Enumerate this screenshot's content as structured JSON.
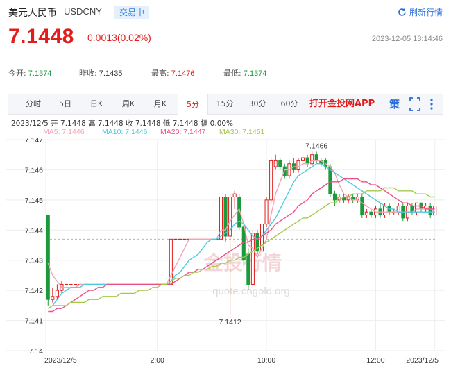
{
  "header": {
    "pair_name": "美元人民币",
    "pair_code": "USDCNY",
    "status": "交易中",
    "refresh_label": "刷新行情"
  },
  "quote": {
    "price": "7.1448",
    "change": "0.0013(0.02%)",
    "timestamp": "2023-12-05 13:14:46"
  },
  "stats": {
    "open_label": "今开:",
    "open": "7.1374",
    "prev_close_label": "昨收:",
    "prev_close": "7.1435",
    "high_label": "最高:",
    "high": "7.1476",
    "low_label": "最低:",
    "low": "7.1374"
  },
  "tabs": [
    "分时",
    "5日",
    "日K",
    "周K",
    "月K",
    "5分",
    "15分",
    "30分",
    "60分"
  ],
  "active_tab": "5分",
  "promo": "打开金投网APP",
  "icons": {
    "strategy": "策",
    "fullscreen": "fullscreen-icon",
    "more": "more-icon"
  },
  "chart_info": {
    "ohlc": "2023/12/5  开 7.1448  高 7.1448  收 7.1448  低 7.1448  幅 0.00%",
    "ma5": "MA5: 7.1446",
    "ma10": "MA10: 7.1446",
    "ma20": "MA20: 7.1447",
    "ma30": "MA30: 7.1451"
  },
  "watermark": "金投行情",
  "watermark_url": "quote.cngold.org",
  "colors": {
    "up": "#e21b1b",
    "down": "#1a9a3a",
    "ma5": "#f4a3b3",
    "ma10": "#4cc9e0",
    "ma20": "#ea4f88",
    "ma30": "#a6c84c"
  },
  "chart_data": {
    "type": "candlestick",
    "ylim": [
      7.14,
      7.147
    ],
    "yticks": [
      "7.147",
      "7.146",
      "7.145",
      "7.144",
      "7.143",
      "7.142",
      "7.141",
      "7.14"
    ],
    "xticks": [
      {
        "label": "2023/12/5",
        "idx": 0
      },
      {
        "label": "2:00",
        "idx": 24
      },
      {
        "label": "10:00",
        "idx": 48
      },
      {
        "label": "12:00",
        "idx": 72
      },
      {
        "label": "2023/12/5",
        "idx": 85
      }
    ],
    "annotations": [
      {
        "label": "7.1466",
        "idx": 59,
        "value": 7.14664
      },
      {
        "label": "7.1412",
        "idx": 40,
        "value": 7.1412
      }
    ],
    "prev_close": 7.1435,
    "candles": [
      [
        7.1445,
        7.1417,
        7.1445,
        7.1415
      ],
      [
        7.1417,
        7.1418,
        7.1421,
        7.1416
      ],
      [
        7.1418,
        7.142,
        7.1422,
        7.1417
      ],
      [
        7.142,
        7.1422,
        7.1423,
        7.1419
      ],
      [
        7.1422,
        7.1422,
        7.1422,
        7.1422
      ],
      [
        7.1422,
        7.1422,
        7.1422,
        7.1422
      ],
      [
        7.1422,
        7.1422,
        7.1422,
        7.1422
      ],
      [
        7.1422,
        7.1422,
        7.1422,
        7.1422
      ],
      [
        7.1422,
        7.1422,
        7.1422,
        7.1422
      ],
      [
        7.1422,
        7.1422,
        7.1422,
        7.1422
      ],
      [
        7.1422,
        7.1422,
        7.1422,
        7.1422
      ],
      [
        7.1422,
        7.1422,
        7.1422,
        7.1422
      ],
      [
        7.1422,
        7.1422,
        7.1422,
        7.1422
      ],
      [
        7.1422,
        7.1422,
        7.1422,
        7.1422
      ],
      [
        7.1422,
        7.1422,
        7.1422,
        7.1422
      ],
      [
        7.1422,
        7.1422,
        7.1422,
        7.1422
      ],
      [
        7.1422,
        7.1422,
        7.1422,
        7.1422
      ],
      [
        7.1422,
        7.1422,
        7.1422,
        7.1422
      ],
      [
        7.1422,
        7.1422,
        7.1422,
        7.1422
      ],
      [
        7.1422,
        7.1422,
        7.1422,
        7.1422
      ],
      [
        7.1422,
        7.1422,
        7.1422,
        7.1422
      ],
      [
        7.1422,
        7.1422,
        7.1422,
        7.1422
      ],
      [
        7.1422,
        7.1422,
        7.1422,
        7.1422
      ],
      [
        7.1422,
        7.1422,
        7.1422,
        7.1422
      ],
      [
        7.1422,
        7.1422,
        7.1422,
        7.1422
      ],
      [
        7.1422,
        7.1422,
        7.1422,
        7.1422
      ],
      [
        7.1422,
        7.1422,
        7.1422,
        7.1422
      ],
      [
        7.1422,
        7.1437,
        7.1437,
        7.1422
      ],
      [
        7.1437,
        7.1437,
        7.1437,
        7.1437
      ],
      [
        7.1437,
        7.1437,
        7.1437,
        7.1437
      ],
      [
        7.1437,
        7.1437,
        7.1437,
        7.1437
      ],
      [
        7.1437,
        7.1437,
        7.1437,
        7.1437
      ],
      [
        7.1437,
        7.1437,
        7.1437,
        7.1437
      ],
      [
        7.1437,
        7.1437,
        7.1437,
        7.1437
      ],
      [
        7.1437,
        7.1437,
        7.1437,
        7.1437
      ],
      [
        7.1437,
        7.1437,
        7.1437,
        7.1437
      ],
      [
        7.1437,
        7.1437,
        7.1437,
        7.1437
      ],
      [
        7.1437,
        7.1437,
        7.1437,
        7.1437
      ],
      [
        7.1437,
        7.1451,
        7.1451,
        7.1437
      ],
      [
        7.1451,
        7.1438,
        7.1452,
        7.1436
      ],
      [
        7.1438,
        7.1451,
        7.1452,
        7.1412
      ],
      [
        7.1451,
        7.1452,
        7.1453,
        7.1447
      ],
      [
        7.1451,
        7.1441,
        7.1452,
        7.144
      ],
      [
        7.1441,
        7.143,
        7.1442,
        7.1428
      ],
      [
        7.1432,
        7.1422,
        7.1434,
        7.142
      ],
      [
        7.1422,
        7.1439,
        7.144,
        7.1421
      ],
      [
        7.1439,
        7.1433,
        7.144,
        7.1432
      ],
      [
        7.1433,
        7.1442,
        7.1443,
        7.1432
      ],
      [
        7.1442,
        7.145,
        7.1451,
        7.1441
      ],
      [
        7.145,
        7.1463,
        7.1464,
        7.1449
      ],
      [
        7.1461,
        7.1463,
        7.1465,
        7.146
      ],
      [
        7.1463,
        7.1461,
        7.1464,
        7.146
      ],
      [
        7.1461,
        7.1458,
        7.1462,
        7.1457
      ],
      [
        7.1458,
        7.1462,
        7.1463,
        7.1457
      ],
      [
        7.1462,
        7.146,
        7.1464,
        7.1459
      ],
      [
        7.146,
        7.1463,
        7.1464,
        7.1459
      ],
      [
        7.1463,
        7.1464,
        7.1466,
        7.1462
      ],
      [
        7.1464,
        7.1462,
        7.1465,
        7.1461
      ],
      [
        7.1462,
        7.1465,
        7.1466,
        7.1461
      ],
      [
        7.1465,
        7.1463,
        7.1466,
        7.1462
      ],
      [
        7.1463,
        7.1462,
        7.1464,
        7.1461
      ],
      [
        7.1463,
        7.1461,
        7.1464,
        7.146
      ],
      [
        7.1461,
        7.1452,
        7.1462,
        7.1451
      ],
      [
        7.1452,
        7.145,
        7.1453,
        7.1448
      ],
      [
        7.145,
        7.1451,
        7.1452,
        7.1449
      ],
      [
        7.1451,
        7.145,
        7.1452,
        7.1449
      ],
      [
        7.145,
        7.1451,
        7.1452,
        7.1449
      ],
      [
        7.1451,
        7.145,
        7.1452,
        7.1449
      ],
      [
        7.145,
        7.1451,
        7.1452,
        7.1449
      ],
      [
        7.1451,
        7.1445,
        7.1452,
        7.1444
      ],
      [
        7.1445,
        7.1446,
        7.1447,
        7.1444
      ],
      [
        7.1446,
        7.1445,
        7.1447,
        7.1444
      ],
      [
        7.1445,
        7.1447,
        7.1448,
        7.1444
      ],
      [
        7.1447,
        7.1445,
        7.1449,
        7.1444
      ],
      [
        7.1445,
        7.1448,
        7.1449,
        7.1444
      ],
      [
        7.1448,
        7.1446,
        7.1449,
        7.1445
      ],
      [
        7.1446,
        7.1446,
        7.1447,
        7.1445
      ],
      [
        7.1446,
        7.1448,
        7.1449,
        7.1445
      ],
      [
        7.1448,
        7.1444,
        7.1449,
        7.1443
      ],
      [
        7.1444,
        7.1448,
        7.1449,
        7.1443
      ],
      [
        7.1448,
        7.1446,
        7.1449,
        7.1445
      ],
      [
        7.1446,
        7.1449,
        7.1449,
        7.1445
      ],
      [
        7.1449,
        7.1447,
        7.1449,
        7.1446
      ],
      [
        7.1447,
        7.1448,
        7.1449,
        7.1446
      ],
      [
        7.1448,
        7.1445,
        7.1449,
        7.1444
      ],
      [
        7.1445,
        7.1448,
        7.1448,
        7.1445
      ]
    ],
    "series": [
      {
        "name": "MA5",
        "values": [
          7.1429,
          7.1425,
          7.1423,
          7.1421,
          7.1421,
          7.1421,
          7.1421,
          7.1422,
          7.1422,
          7.1422,
          7.1422,
          7.1422,
          7.1422,
          7.1422,
          7.1422,
          7.1422,
          7.1422,
          7.1422,
          7.1422,
          7.1422,
          7.1422,
          7.1422,
          7.1422,
          7.1422,
          7.1422,
          7.1422,
          7.1422,
          7.1425,
          7.1428,
          7.1431,
          7.1434,
          7.1437,
          7.1437,
          7.1437,
          7.1437,
          7.1437,
          7.1437,
          7.1437,
          7.144,
          7.144,
          7.1443,
          7.1445,
          7.1447,
          7.1442,
          7.1435,
          7.1434,
          7.1431,
          7.1434,
          7.1437,
          7.1445,
          7.1452,
          7.1456,
          7.146,
          7.146,
          7.1461,
          7.1461,
          7.1462,
          7.1462,
          7.1463,
          7.1463,
          7.1463,
          7.1462,
          7.1461,
          7.1459,
          7.1455,
          7.1452,
          7.1451,
          7.145,
          7.145,
          7.1449,
          7.1448,
          7.1447,
          7.1446,
          7.1446,
          7.1446,
          7.1446,
          7.1446,
          7.1446,
          7.1446,
          7.1446,
          7.1446,
          7.1447,
          7.1447,
          7.1447,
          7.1447,
          7.1446
        ]
      },
      {
        "name": "MA10",
        "values": [
          7.1414,
          7.1415,
          7.1417,
          7.1419,
          7.142,
          7.1421,
          7.1421,
          7.1421,
          7.1422,
          7.1422,
          7.1422,
          7.1422,
          7.1422,
          7.1422,
          7.1422,
          7.1422,
          7.1422,
          7.1422,
          7.1422,
          7.1422,
          7.1422,
          7.1422,
          7.1422,
          7.1422,
          7.1422,
          7.1422,
          7.1422,
          7.1423,
          7.1425,
          7.1426,
          7.1428,
          7.143,
          7.1431,
          7.1432,
          7.1434,
          7.1436,
          7.1437,
          7.1437,
          7.1438,
          7.1439,
          7.144,
          7.1442,
          7.1443,
          7.1442,
          7.144,
          7.1438,
          7.1437,
          7.1438,
          7.144,
          7.1442,
          7.1444,
          7.1447,
          7.145,
          7.1453,
          7.1456,
          7.1458,
          7.1459,
          7.146,
          7.1461,
          7.1462,
          7.1462,
          7.1461,
          7.146,
          7.1459,
          7.1458,
          7.1457,
          7.1456,
          7.1455,
          7.1454,
          7.1453,
          7.1452,
          7.1451,
          7.145,
          7.1449,
          7.1448,
          7.1447,
          7.1447,
          7.1446,
          7.1446,
          7.1446,
          7.1446,
          7.1446,
          7.1446,
          7.1446,
          7.1446,
          7.1446
        ]
      },
      {
        "name": "MA20",
        "values": [
          7.1413,
          7.1413,
          7.1414,
          7.1414,
          7.1415,
          7.1416,
          7.1417,
          7.1418,
          7.1419,
          7.142,
          7.142,
          7.1421,
          7.1421,
          7.1422,
          7.1422,
          7.1422,
          7.1422,
          7.1422,
          7.1422,
          7.1422,
          7.1422,
          7.1422,
          7.1422,
          7.1422,
          7.1422,
          7.1422,
          7.1422,
          7.1422,
          7.1423,
          7.1424,
          7.1425,
          7.1426,
          7.1426,
          7.1427,
          7.1427,
          7.1428,
          7.1429,
          7.143,
          7.1431,
          7.1432,
          7.1433,
          7.1434,
          7.1435,
          7.1436,
          7.1436,
          7.1437,
          7.1437,
          7.1438,
          7.1439,
          7.144,
          7.1442,
          7.1443,
          7.1444,
          7.1445,
          7.1446,
          7.1448,
          7.1449,
          7.145,
          7.1452,
          7.1453,
          7.1454,
          7.1455,
          7.1456,
          7.1456,
          7.1456,
          7.1457,
          7.1457,
          7.1457,
          7.1457,
          7.1456,
          7.1456,
          7.1455,
          7.1455,
          7.1454,
          7.1453,
          7.1452,
          7.1451,
          7.145,
          7.1449,
          7.1449,
          7.1448,
          7.1448,
          7.1448,
          7.1447,
          7.1447,
          7.1447
        ]
      },
      {
        "name": "MA30",
        "values": [
          7.1414,
          7.1415,
          7.1415,
          7.1415,
          7.1415,
          7.1416,
          7.1416,
          7.1416,
          7.1416,
          7.1417,
          7.1417,
          7.1417,
          7.1418,
          7.1418,
          7.1418,
          7.1418,
          7.1419,
          7.1419,
          7.1419,
          7.1419,
          7.142,
          7.142,
          7.142,
          7.1421,
          7.1421,
          7.1422,
          7.1422,
          7.1423,
          7.1424,
          7.1424,
          7.1425,
          7.1425,
          7.1426,
          7.1426,
          7.1427,
          7.1427,
          7.1428,
          7.1428,
          7.1429,
          7.1429,
          7.143,
          7.143,
          7.1431,
          7.1431,
          7.1432,
          7.1433,
          7.1434,
          7.1435,
          7.1436,
          7.1437,
          7.1438,
          7.1439,
          7.144,
          7.1441,
          7.1442,
          7.1443,
          7.1444,
          7.1444,
          7.1445,
          7.1446,
          7.1447,
          7.1448,
          7.1449,
          7.1449,
          7.145,
          7.1451,
          7.1451,
          7.1452,
          7.1452,
          7.1452,
          7.1453,
          7.1453,
          7.1453,
          7.1453,
          7.1454,
          7.1454,
          7.1454,
          7.1453,
          7.1453,
          7.1453,
          7.1453,
          7.1452,
          7.1452,
          7.1452,
          7.1451,
          7.1451
        ]
      }
    ]
  }
}
